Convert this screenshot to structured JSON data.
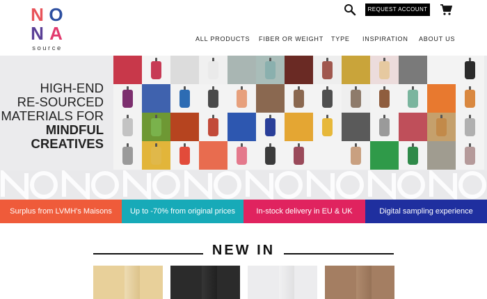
{
  "brand": {
    "letters": [
      "N",
      "O",
      "N",
      "A"
    ],
    "letter_colors": [
      "#e8535a",
      "#2d4fa0",
      "#5a3f96",
      "#e23a6e"
    ],
    "sub": "source"
  },
  "header": {
    "request_label": "REQUEST ACCOUNT",
    "search_icon": "search-icon",
    "cart_icon": "cart-icon"
  },
  "nav": {
    "items": [
      "ALL PRODUCTS",
      "FIBER OR WEIGHT",
      "TYPE",
      "INSPIRATION",
      "ABOUT US"
    ]
  },
  "hero": {
    "line1": "HIGH-END",
    "line2": "RE-SOURCED",
    "line3": "MATERIALS FOR",
    "line4": "MINDFUL",
    "line5": "CREATIVES"
  },
  "features": [
    {
      "label": "Surplus from LVMH's Maisons",
      "color": "#ef5b3a"
    },
    {
      "label": "Up to -70% from original prices",
      "color": "#17aab8"
    },
    {
      "label": "In-stock delivery in EU & UK",
      "color": "#e0235f"
    },
    {
      "label": "Digital sampling experience",
      "color": "#1f2f9f"
    }
  ],
  "newin": {
    "title": "NEW IN"
  },
  "products": [
    {
      "color": "#e8d09a"
    },
    {
      "color": "#2b2b2b"
    },
    {
      "color": "#ececee"
    },
    {
      "color": "#a47e62"
    }
  ],
  "tiles": [
    [
      "#c8384a",
      "#f4f4f4",
      "#dcdcdc",
      "#f0f0f0",
      "#a9b6b3",
      "#a9bdb9",
      "#6a2a24",
      "#eee",
      "#c9a43a",
      "#ecdcdc",
      "#7a7a7a",
      "#f3f3f3",
      "#f3f3f3"
    ],
    [
      "#f3f3f3",
      "#3f62ae",
      "#f3f3f3",
      "#f3f3f3",
      "#f3f3f3",
      "#8a6850",
      "#f3f3f3",
      "#f3f3f3",
      "#efefef",
      "#f3f3f3",
      "#f3f3f3",
      "#e8792f",
      "#f3f3f3"
    ],
    [
      "#f3f3f3",
      "#6e9834",
      "#b6441f",
      "#f3f3f3",
      "#2d57b0",
      "#f3f3f3",
      "#e4a633",
      "#f3f3f3",
      "#5a5a5a",
      "#f3f3f3",
      "#bf4f5a",
      "#c5a06c",
      "#f3f3f3"
    ],
    [
      "#f3f3f3",
      "#e2b53a",
      "#f3f3f3",
      "#e86c4f",
      "#f3f3f3",
      "#f3f3f3",
      "#f3f3f3",
      "#f3f3f3",
      "#f3f3f3",
      "#2f9a49",
      "#f3f3f3",
      "#a09c90",
      "#f3f3f3"
    ]
  ],
  "drapes": [
    [
      "",
      "#c73b55",
      "",
      "#eaeaea",
      "",
      "#8ab0ae",
      "",
      "#a0584f",
      "",
      "#e6c9a0",
      "",
      "",
      "#2b2b2b"
    ],
    [
      "#7c2f6e",
      "",
      "#2d6cb3",
      "#4a4a4a",
      "#e7a07c",
      "",
      "#8a6850",
      "#4f4f4f",
      "#8e7b6b",
      "#8f5d3e",
      "#7ab59e",
      "",
      "#d98840"
    ],
    [
      "#c3c3c3",
      "#7ab24c",
      "",
      "#c24a39",
      "",
      "#2a3f99",
      "",
      "#e7b83a",
      "",
      "#9a9a9a",
      "",
      "#c28a4a",
      "#b0b0b0"
    ],
    [
      "#9a9a9a",
      "#e0b84a",
      "#e24b3a",
      "",
      "#e4798c",
      "#3b3b3b",
      "#9a4a5a",
      "",
      "#c9a080",
      "",
      "#2f8a49",
      "",
      "#b59a9a"
    ]
  ]
}
